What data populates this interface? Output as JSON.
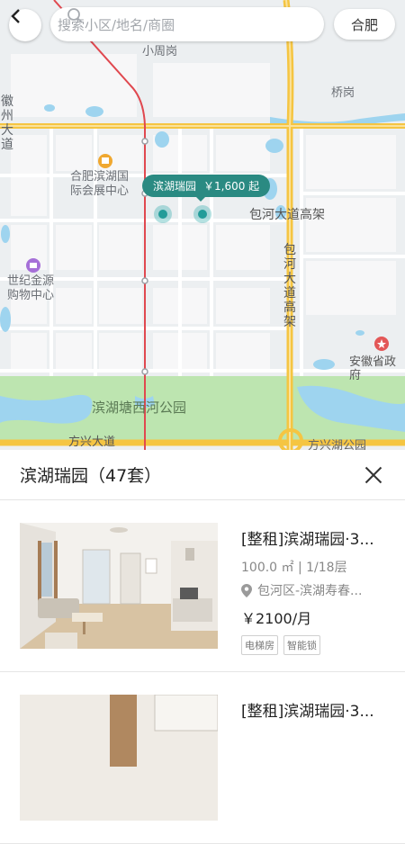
{
  "search": {
    "placeholder": "搜索小区/地名/商圈"
  },
  "city": "合肥",
  "map": {
    "labels": {
      "xiaozhougang": "小周岗",
      "qiaogang": "桥岗",
      "huizhou": "徽州大道",
      "expo": "合肥滨湖国际会展中心",
      "shiji": "世纪金源购物中心",
      "baohe_gaojia_h": "包河大道高架",
      "baohe_gaojia_v": "包河大道高架",
      "anhui_gov": "安徽省政府",
      "park": "滨湖塘西河公园",
      "fangxing": "方兴大道",
      "fangxing_park": "方兴湖公园"
    },
    "pin": {
      "name": "滨湖瑞园",
      "price": "￥1,600 起"
    }
  },
  "sheet": {
    "title": "滨湖瑞园（47套）",
    "listings": [
      {
        "title": "[整租]滨湖瑞园·3...",
        "meta": "100.0 ㎡ | 1/18层",
        "location": "包河区-滨湖寿春...",
        "price": "￥2100/月",
        "tags": [
          "电梯房",
          "智能锁"
        ]
      },
      {
        "title": "[整租]滨湖瑞园·3..."
      }
    ]
  },
  "colors": {
    "accent": "#2a8a82",
    "road": "#f5c542",
    "water": "#9ed4ef",
    "park": "#bde5b0"
  }
}
